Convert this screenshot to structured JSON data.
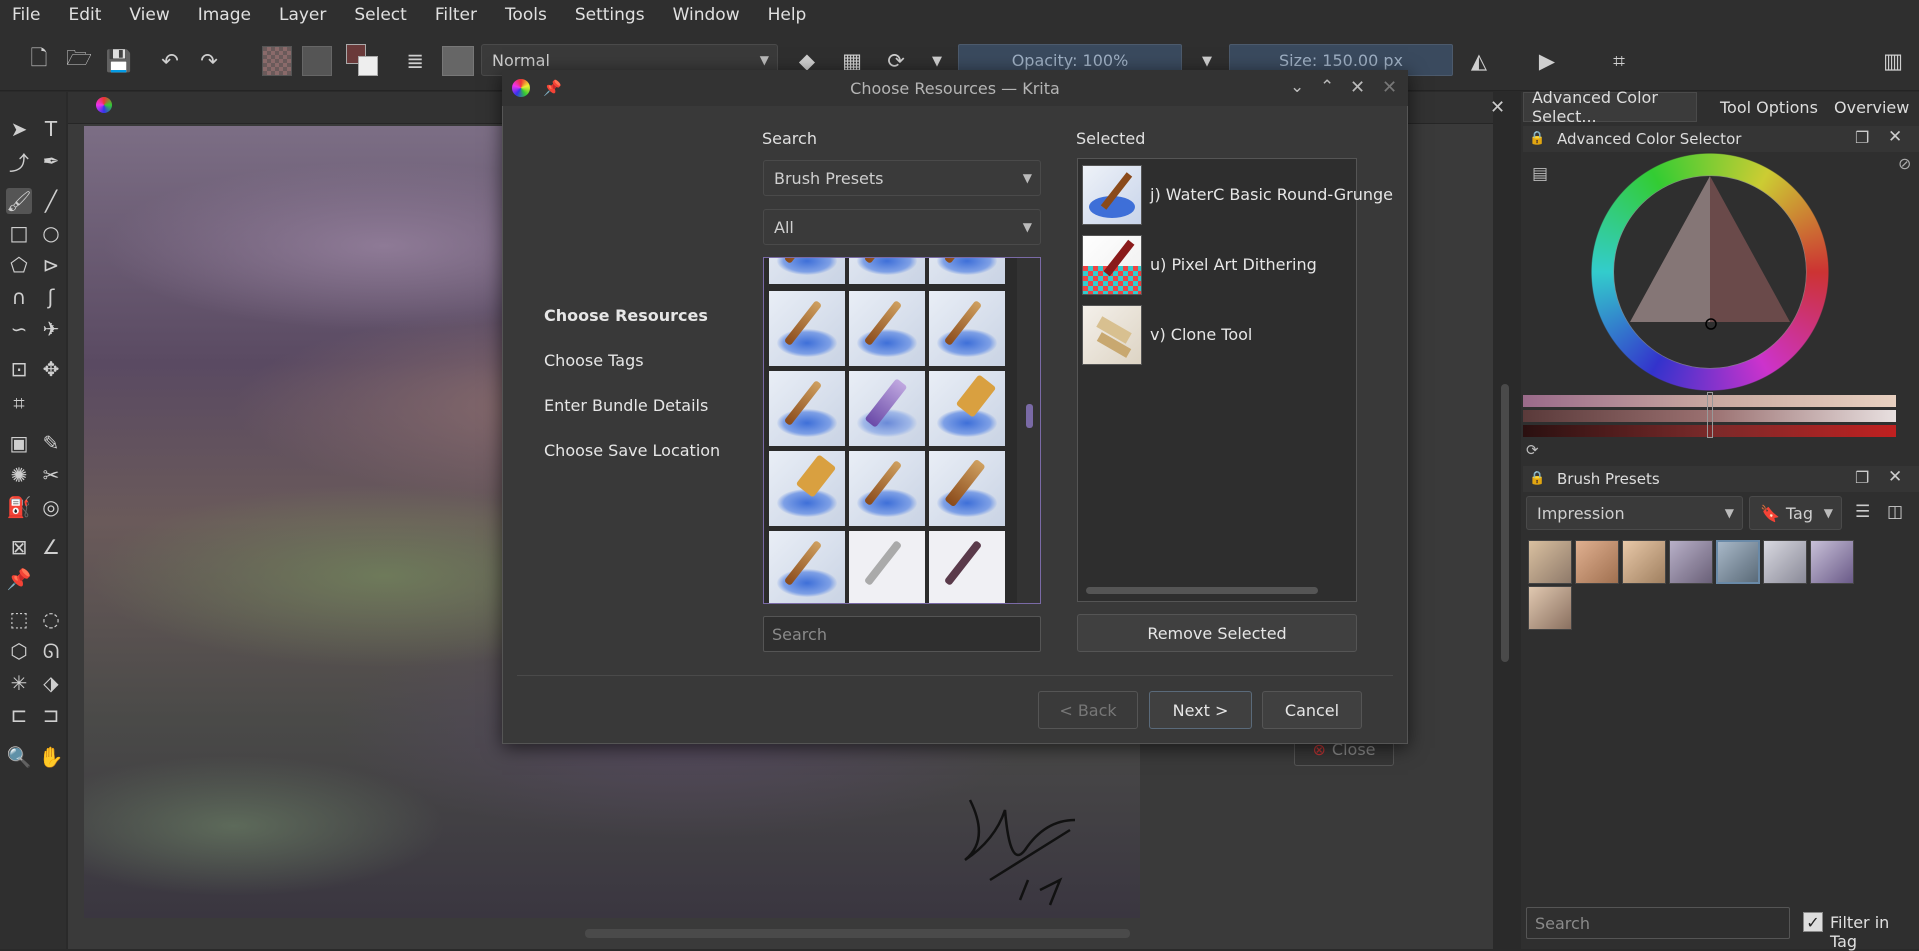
{
  "menubar": [
    "File",
    "Edit",
    "View",
    "Image",
    "Layer",
    "Select",
    "Filter",
    "Tools",
    "Settings",
    "Window",
    "Help"
  ],
  "toolbar": {
    "blend_mode": "Normal",
    "opacity": "Opacity: 100%",
    "size": "Size: 150.00 px"
  },
  "dock": {
    "tabs": [
      "Advanced Color Select...",
      "Tool Options",
      "Overview"
    ],
    "color_selector_title": "Advanced Color Selector",
    "brush_presets_title": "Brush Presets",
    "preset_tag_combo": "Impression",
    "tag_button": "Tag",
    "search_placeholder": "Search",
    "filter_in_tag": "Filter in Tag"
  },
  "dialog": {
    "title": "Choose Resources — Krita",
    "nav": [
      "Choose Resources",
      "Choose Tags",
      "Enter Bundle Details",
      "Choose Save Location"
    ],
    "search_label": "Search",
    "resource_type": "Brush Presets",
    "filter": "All",
    "search_placeholder": "Search",
    "selected_label": "Selected",
    "selected_items": [
      {
        "name": "j) WaterC Basic Round-Grunge"
      },
      {
        "name": "u) Pixel Art Dithering"
      },
      {
        "name": "v) Clone Tool"
      }
    ],
    "remove_button": "Remove Selected",
    "back_button": "< Back",
    "next_button": "Next >",
    "cancel_button": "Cancel",
    "behind_close": "Close"
  },
  "colors": {
    "accent": "#7a6aa6",
    "dialog_bg": "#393939",
    "app_bg": "#2f2f2f"
  }
}
